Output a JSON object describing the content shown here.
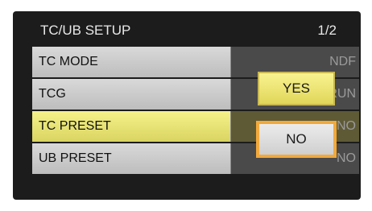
{
  "header": {
    "title": "TC/UB SETUP",
    "page": "1/2"
  },
  "menu": {
    "items": [
      {
        "label": "TC MODE",
        "value": "NDF",
        "selected": false
      },
      {
        "label": "TCG",
        "value": "REC RUN",
        "selected": false
      },
      {
        "label": "TC PRESET",
        "value": "NO",
        "selected": true
      },
      {
        "label": "UB PRESET",
        "value": "NO",
        "selected": false
      }
    ]
  },
  "dialog": {
    "yes_label": "YES",
    "no_label": "NO",
    "focused": "NO"
  },
  "colors": {
    "selected_row": "#f3ee86",
    "focus_border": "#f2a93b",
    "screen_bg": "#1c1c1c"
  }
}
